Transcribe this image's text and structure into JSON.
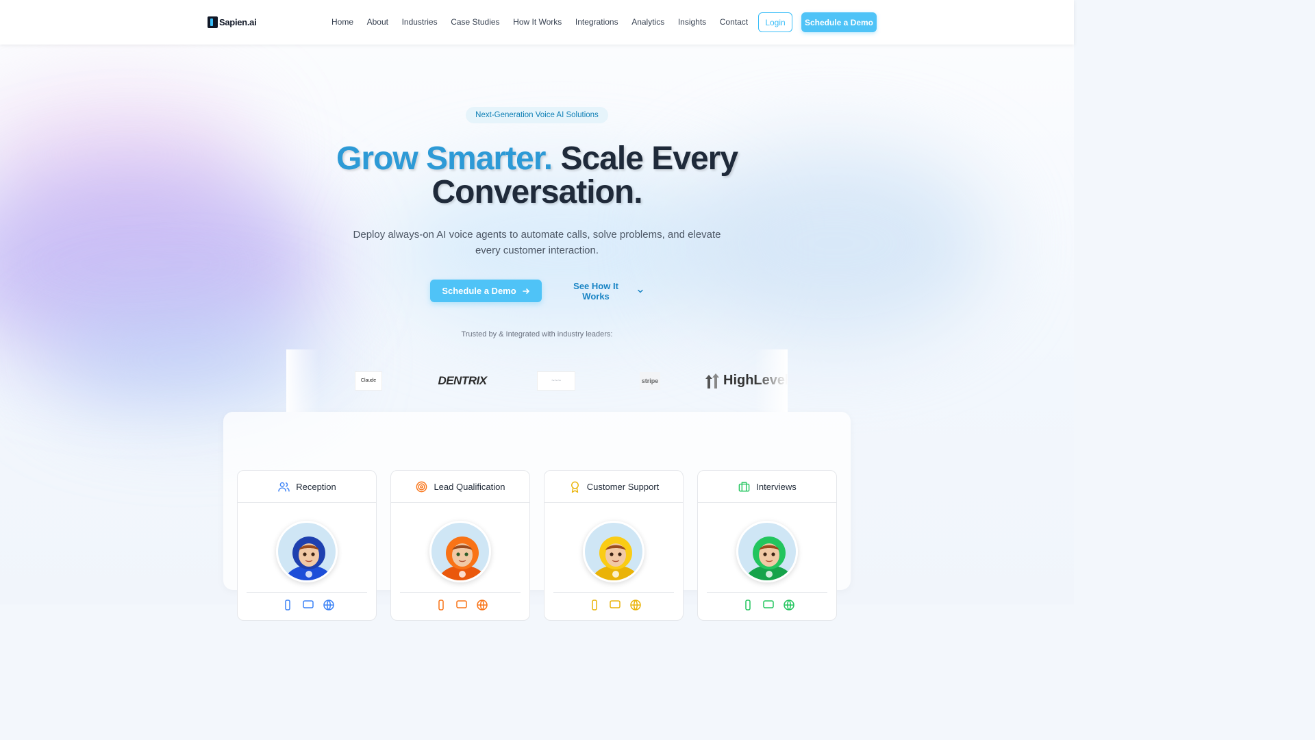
{
  "brand": {
    "name": "Sapien.ai"
  },
  "nav": {
    "items": [
      "Home",
      "About",
      "Industries",
      "Case Studies",
      "How It Works",
      "Integrations",
      "Analytics",
      "Insights",
      "Contact"
    ],
    "login_label": "Login",
    "demo_label": "Schedule a Demo"
  },
  "hero": {
    "badge": "Next-Generation Voice AI Solutions",
    "headline_accent": "Grow Smarter.",
    "headline_rest_1": "Scale Every",
    "headline_rest_2": "Conversation.",
    "subhead": "Deploy always-on AI voice agents to automate calls, solve problems, and elevate every customer interaction.",
    "primary_cta": "Schedule a Demo",
    "secondary_cta": "See How It Works",
    "trusted_text": "Trusted by & Integrated with industry leaders:"
  },
  "partners": {
    "claude": "Claude",
    "dentrix": "DENTRIX",
    "stripe": "stripe",
    "highlevel": "HighLevel"
  },
  "cards": [
    {
      "label": "Reception",
      "icon": "users-icon",
      "color": "#3b82f6"
    },
    {
      "label": "Lead Qualification",
      "icon": "target-icon",
      "color": "#f97316"
    },
    {
      "label": "Customer Support",
      "icon": "award-icon",
      "color": "#eab308"
    },
    {
      "label": "Interviews",
      "icon": "briefcase-icon",
      "color": "#22c55e"
    }
  ],
  "colors": {
    "accent": "#4fc3f7",
    "headline_accent": "#2d9ad6",
    "link": "#1783c4"
  }
}
